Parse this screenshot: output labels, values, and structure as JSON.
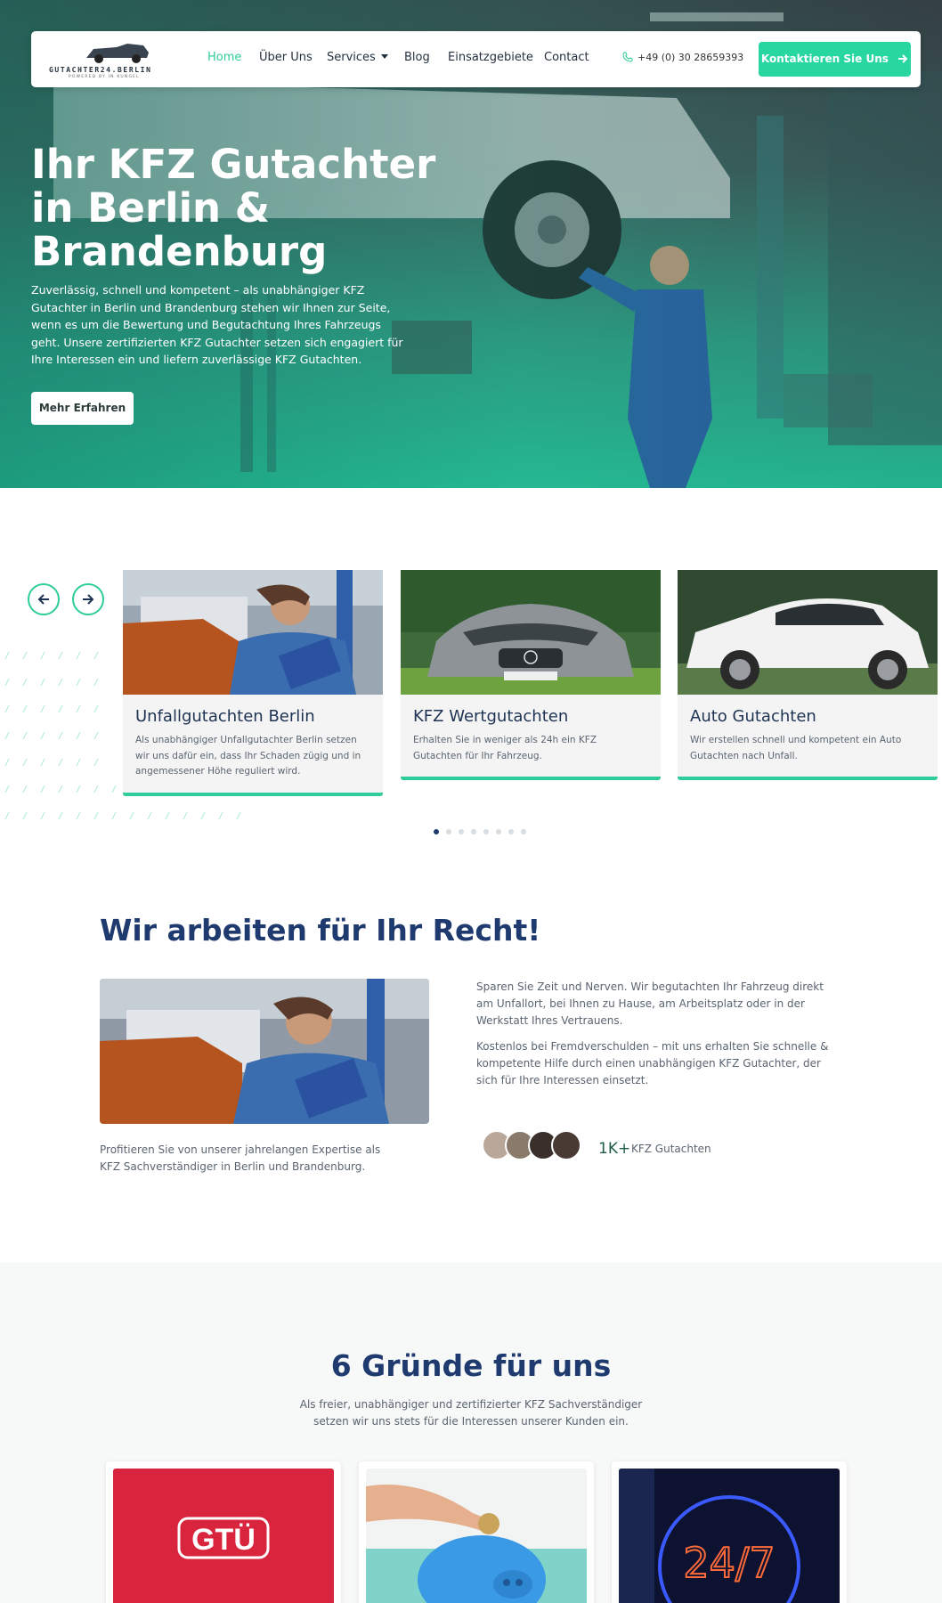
{
  "nav": {
    "logo_text": "GUTACHTER24.BERLIN",
    "logo_sub": "POWERED BY IN KUNGEL",
    "links": [
      "Home",
      "Über Uns",
      "Services",
      "Blog",
      "Einsatzgebiete",
      "Contact"
    ],
    "phone": "+49 (0) 30 28659393",
    "cta": "Kontaktieren Sie Uns"
  },
  "hero": {
    "title": "Ihr KFZ Gutachter in Berlin & Brandenburg",
    "text": "Zuverlässig, schnell und kompetent – als unabhängiger KFZ Gutachter in Berlin und Brandenburg stehen wir Ihnen zur Seite, wenn es um die Bewertung und Begutachtung Ihres Fahrzeugs geht. Unsere zertifizierten KFZ Gutachter setzen sich engagiert für Ihre Interessen ein und liefern zuverlässige KFZ Gutachten.",
    "button": "Mehr Erfahren"
  },
  "services": [
    {
      "title": "Unfallgutachten Berlin",
      "text": "Als unabhängiger Unfallgutachter Berlin setzen wir uns dafür ein, dass Ihr Schaden zügig und in angemessener Höhe reguliert wird."
    },
    {
      "title": "KFZ Wertgutachten",
      "text": "Erhalten Sie in weniger als 24h ein KFZ Gutachten für Ihr Fahrzeug."
    },
    {
      "title": "Auto Gutachten",
      "text": "Wir erstellen schnell und kompetent ein Auto Gutachten nach Unfall."
    }
  ],
  "about": {
    "title": "Wir arbeiten für Ihr Recht!",
    "caption": "Profitieren Sie von unserer jahrelangen Expertise als KFZ Sachverständiger in Berlin und Brandenburg.",
    "p1": "Sparen Sie Zeit und Nerven. Wir begutachten Ihr Fahrzeug direkt am Unfallort, bei Ihnen zu Hause, am Arbeitsplatz oder in der Werkstatt Ihres Vertrauens.",
    "p2": "Kostenlos bei Fremdverschulden – mit uns erhalten Sie schnelle & kompetente Hilfe durch einen unabhängigen KFZ Gutachter, der sich für Ihre Interessen einsetzt.",
    "stat_number": "1K+",
    "stat_label": "KFZ Gutachten"
  },
  "reasons": {
    "title": "6 Gründe für uns",
    "subtitle": "Als freier, unabhängiger und zertifizierter KFZ Sachverständiger setzen wir uns stets für die Interessen unserer Kunden ein.",
    "logo_text": "GTÜ",
    "sign_text": "24/7"
  },
  "colors": {
    "accent": "#2ecc9b",
    "heading": "#1e3a6e",
    "gtu_red": "#d9243d"
  }
}
